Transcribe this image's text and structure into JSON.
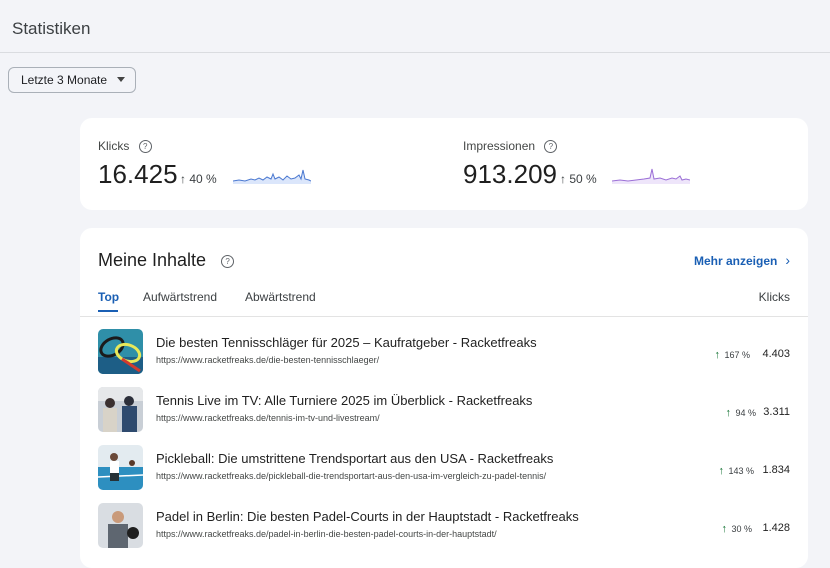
{
  "header": {
    "title": "Statistiken"
  },
  "filter": {
    "date_range": "Letzte 3 Monate"
  },
  "metrics": {
    "clicks": {
      "label": "Klicks",
      "value": "16.425",
      "delta": "40 %"
    },
    "impressions": {
      "label": "Impressionen",
      "value": "913.209",
      "delta": "50 %"
    }
  },
  "content": {
    "title": "Meine Inhalte",
    "more_link": "Mehr anzeigen",
    "tabs": [
      "Top",
      "Aufwärtstrend",
      "Abwärtstrend"
    ],
    "column_header": "Klicks",
    "rows": [
      {
        "title": "Die besten Tennisschläger für 2025 – Kaufratgeber - Racketfreaks",
        "url": "https://www.racketfreaks.de/die-besten-tennisschlaeger/",
        "delta": "167 %",
        "clicks": "4.403"
      },
      {
        "title": "Tennis Live im TV: Alle Turniere 2025 im Überblick - Racketfreaks",
        "url": "https://www.racketfreaks.de/tennis-im-tv-und-livestream/",
        "delta": "94 %",
        "clicks": "3.311"
      },
      {
        "title": "Pickleball: Die umstrittene Trendsportart aus den USA - Racketfreaks",
        "url": "https://www.racketfreaks.de/pickleball-die-trendsportart-aus-den-usa-im-vergleich-zu-padel-tennis/",
        "delta": "143 %",
        "clicks": "1.834"
      },
      {
        "title": "Padel in Berlin: Die besten Padel-Courts in der Hauptstadt - Racketfreaks",
        "url": "https://www.racketfreaks.de/padel-in-berlin-die-besten-padel-courts-in-der-hauptstadt/",
        "delta": "30 %",
        "clicks": "1.428"
      }
    ]
  },
  "colors": {
    "accent": "#1a5fb4",
    "up_arrow": "#137333",
    "clicks_spark": "#4a78d0",
    "impressions_spark": "#9b6fd6"
  }
}
